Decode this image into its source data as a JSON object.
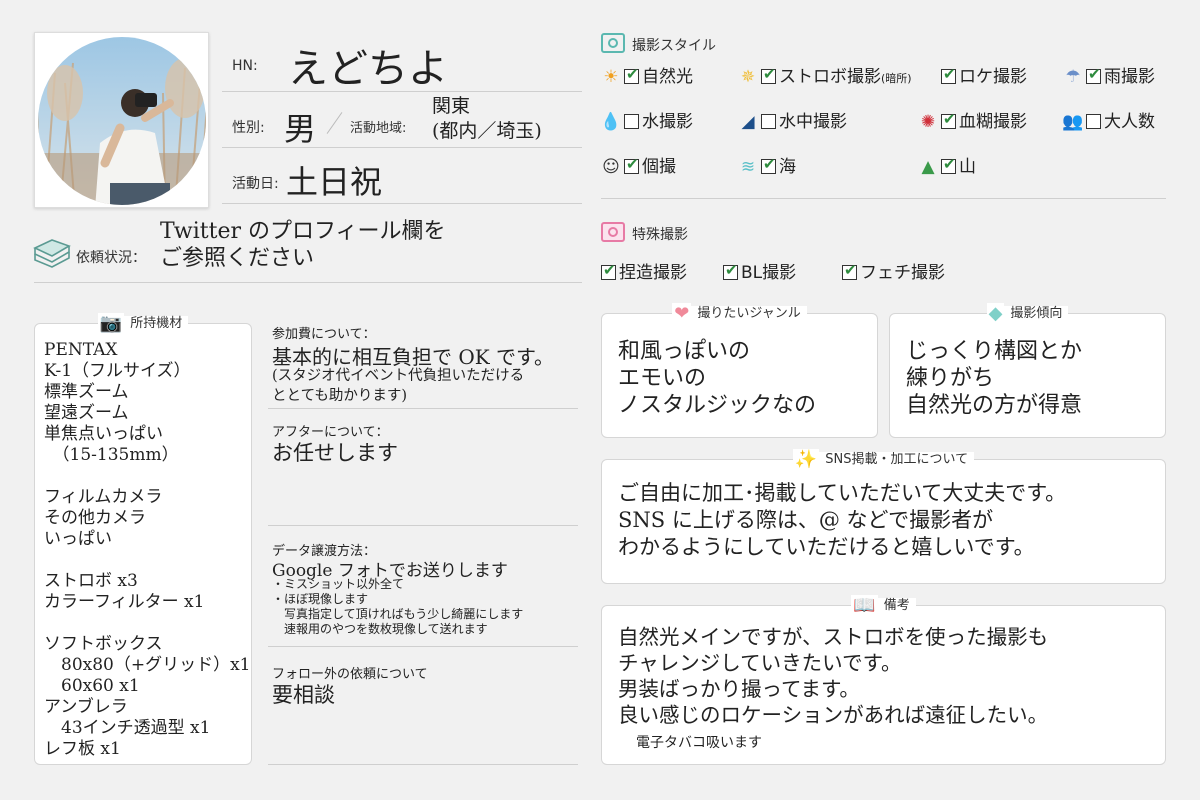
{
  "profile": {
    "hn_label": "HN:",
    "name": "えどちよ",
    "gender_label": "性別:",
    "gender": "男",
    "area_label": "活動地域:",
    "area_lines": [
      "関東",
      "(都内／埼玉)"
    ],
    "days_label": "活動日:",
    "days": "土日祝",
    "request_label": "依頼状況：",
    "request_lines": [
      "Twitter のプロフィール欄を",
      "ご参照ください"
    ]
  },
  "equipment": {
    "title": "所持機材",
    "lines": [
      "PENTAX",
      "K-1（フルサイズ）",
      "標準ズーム",
      "望遠ズーム",
      "単焦点いっぱい",
      "　（15-135mm）",
      "",
      "フィルムカメラ",
      "その他カメラ",
      "いっぱい",
      "",
      "ストロボ x3",
      "カラーフィルター x1",
      "",
      "ソフトボックス",
      "　80x80（+グリッド）x1",
      "　60x60 x1",
      "アンブレラ",
      "　43インチ透過型 x1",
      "レフ板 x1"
    ]
  },
  "fee": {
    "label": "参加費について：",
    "main": "基本的に相互負担で OK です。",
    "note_lines": [
      "(スタジオ代イベント代負担いただける",
      "ととても助かります)"
    ]
  },
  "after": {
    "label": "アフターについて：",
    "value": "お任せします"
  },
  "data_transfer": {
    "label": "データ譲渡方法：",
    "main": "Google フォトでお送りします",
    "note_lines": [
      "・ミスショット以外全て",
      "・ほぼ現像します",
      "　写真指定して頂ければもう少し綺麗にします",
      "　速報用のやつを数枚現像して送れます"
    ]
  },
  "non_follower": {
    "label": "フォロー外の依頼について",
    "value": "要相談"
  },
  "style": {
    "title": "撮影スタイル",
    "items": [
      {
        "icon": "sun-icon",
        "glyph": "☀",
        "color": "#f0a020",
        "checked": true,
        "label": "自然光",
        "suffix": ""
      },
      {
        "icon": "flash-icon",
        "glyph": "✵",
        "color": "#f0c040",
        "checked": true,
        "label": "ストロボ撮影",
        "suffix": "(暗所)"
      },
      {
        "icon": "location-icon",
        "glyph": "",
        "color": "#444",
        "checked": true,
        "label": "ロケ撮影",
        "suffix": ""
      },
      {
        "icon": "umbrella-icon",
        "glyph": "☂",
        "color": "#6b8fc9",
        "checked": true,
        "label": "雨撮影",
        "suffix": ""
      },
      {
        "icon": "water-drop-icon",
        "glyph": "💧",
        "color": "#3b8fd0",
        "checked": false,
        "label": "水撮影",
        "suffix": ""
      },
      {
        "icon": "swimmer-icon",
        "glyph": "◢",
        "color": "#1d4f8a",
        "checked": false,
        "label": "水中撮影",
        "suffix": ""
      },
      {
        "icon": "blood-icon",
        "glyph": "✺",
        "color": "#d0303a",
        "checked": true,
        "label": "血糊撮影",
        "suffix": ""
      },
      {
        "icon": "crowd-icon",
        "glyph": "👥",
        "color": "#a08040",
        "checked": false,
        "label": "大人数",
        "suffix": ""
      },
      {
        "icon": "person-icon",
        "glyph": "☺",
        "color": "#333",
        "checked": true,
        "label": "個撮",
        "suffix": ""
      },
      {
        "icon": "wave-icon",
        "glyph": "≋",
        "color": "#5bc0c8",
        "checked": true,
        "label": "海",
        "suffix": ""
      },
      {
        "icon": "mountain-icon",
        "glyph": "▲",
        "color": "#3a9a4a",
        "checked": true,
        "label": "山",
        "suffix": ""
      }
    ]
  },
  "special": {
    "title": "特殊撮影",
    "items": [
      {
        "checked": true,
        "label": "捏造撮影"
      },
      {
        "checked": true,
        "label": "BL撮影"
      },
      {
        "checked": true,
        "label": "フェチ撮影"
      }
    ]
  },
  "genre": {
    "title": "撮りたいジャンル",
    "lines": [
      "和風っぽいの",
      "エモいの",
      "ノスタルジックなの"
    ]
  },
  "tendency": {
    "title": "撮影傾向",
    "lines": [
      "じっくり構図とか",
      "練りがち",
      "自然光の方が得意"
    ]
  },
  "sns": {
    "title": "SNS掲載・加工について",
    "lines": [
      "ご自由に加工･掲載していただいて大丈夫です。",
      "SNS に上げる際は、@ などで撮影者が",
      "わかるようにしていただけると嬉しいです。"
    ]
  },
  "notes": {
    "title": "備考",
    "lines": [
      "自然光メインですが、ストロボを使った撮影も",
      "チャレンジしていきたいです。",
      "男装ばっかり撮ってます。",
      "良い感じのロケーションがあれば遠征したい。"
    ],
    "small": "電子タバコ吸います"
  },
  "colors": {
    "camera_icon": "#5bb8b0",
    "heart": "#f08a9a",
    "gem": "#7fd0c8",
    "check": "#2e8b3e"
  }
}
